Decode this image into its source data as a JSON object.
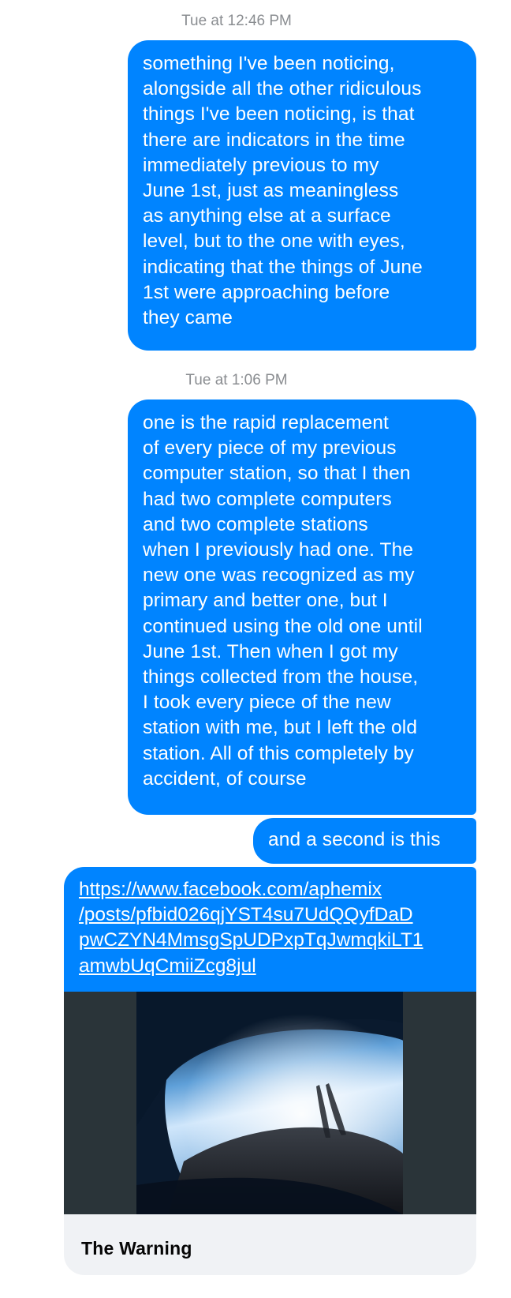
{
  "conversation": {
    "timestamps": [
      "Tue at 12:46 PM",
      "Tue at 1:06 PM"
    ],
    "messages": [
      "something I've been noticing,\nalongside all the other ridiculous\nthings I've been noticing, is that\nthere are indicators in the time\nimmediately previous to my\nJune 1st, just as meaningless\nas anything else at a surface\nlevel, but to the one with eyes,\nindicating that the things of June\n1st were approaching before\nthey came",
      "one is the rapid replacement\nof every piece of my previous\ncomputer station, so that I then\nhad two complete computers\nand two complete stations\nwhen I previously had one. The\nnew one was recognized as my\nprimary and better one, but I\ncontinued using the old one until\nJune 1st. Then when I got my\nthings collected from the house,\nI took every piece of the new\nstation with me, but I left the old\nstation. All of this completely by\naccident, of course",
      "and a second is this"
    ],
    "link_card": {
      "url": "https://www.facebook.com/aphemix\n/posts/pfbid026qjYST4su7UdQQyfDaD\npwCZYN4MmsgSpUDPxpTqJwmqkiLT1\namwbUqCmiiZcg8jul",
      "title": "The Warning"
    }
  },
  "colors": {
    "bubble": "#0084ff",
    "timestamp": "#8a8d91",
    "card_footer": "#f0f2f5",
    "preview_bg": "#2a3439"
  }
}
